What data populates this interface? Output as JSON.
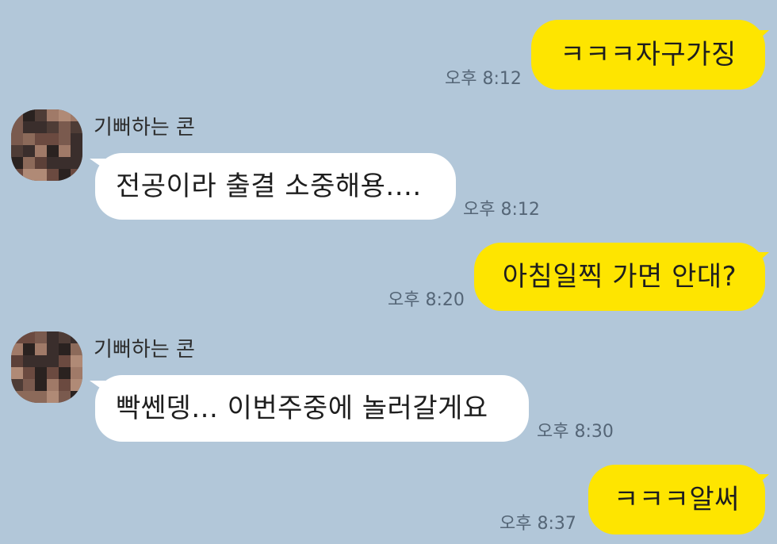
{
  "messages": [
    {
      "side": "mine",
      "text": "ㅋㅋㅋ자구가징",
      "time": "오후 8:12"
    },
    {
      "side": "theirs",
      "sender": "기뻐하는 콘",
      "text": "전공이라 출결 소중해용....",
      "time": "오후 8:12"
    },
    {
      "side": "mine",
      "text": "아침일찍 가면 안대?",
      "time": "오후 8:20"
    },
    {
      "side": "theirs",
      "sender": "기뻐하는 콘",
      "text": "빡쎈뎅... 이번주중에 놀러갈게요",
      "time": "오후 8:30"
    },
    {
      "side": "mine",
      "text": "ㅋㅋㅋ알써",
      "time": "오후 8:37"
    }
  ],
  "colors": {
    "background": "#b2c7d9",
    "my_bubble": "#fee500",
    "their_bubble": "#ffffff"
  },
  "avatar": {
    "icon": "pixelated-avatar-icon"
  }
}
